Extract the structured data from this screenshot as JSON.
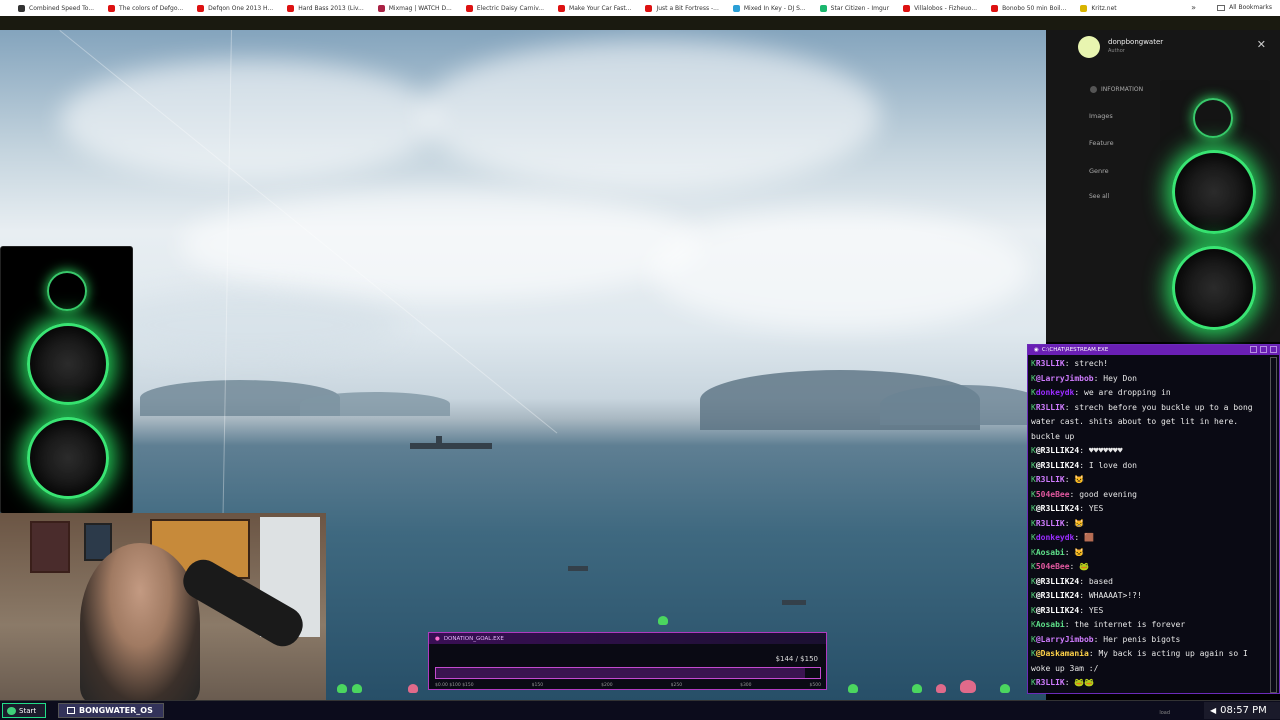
{
  "bookmarks": {
    "items": [
      {
        "label": "Combined Speed To...",
        "icon": "speed-icon",
        "color": "#333333"
      },
      {
        "label": "The colors of Defgo...",
        "icon": "youtube-icon",
        "color": "#dd1111"
      },
      {
        "label": "Defqon One 2013 H...",
        "icon": "youtube-icon",
        "color": "#dd1111"
      },
      {
        "label": "Hard Bass 2013 (Liv...",
        "icon": "youtube-icon",
        "color": "#dd1111"
      },
      {
        "label": "Mixmag | WATCH D...",
        "icon": "mixmag-icon",
        "color": "#aa2244"
      },
      {
        "label": "Electric Daisy Carniv...",
        "icon": "youtube-icon",
        "color": "#dd1111"
      },
      {
        "label": "Make Your Car Fast...",
        "icon": "youtube-icon",
        "color": "#dd1111"
      },
      {
        "label": "Just a Bit Fortress -...",
        "icon": "youtube-icon",
        "color": "#dd1111"
      },
      {
        "label": "Mixed In Key - DJ S...",
        "icon": "mixedinkey-icon",
        "color": "#2a9fd6"
      },
      {
        "label": "Star Citizen - Imgur",
        "icon": "imgur-icon",
        "color": "#1bb76e"
      },
      {
        "label": "Villalobos - Fizheuo...",
        "icon": "youtube-icon",
        "color": "#dd1111"
      },
      {
        "label": "Bonobo 50 min Boil...",
        "icon": "youtube-icon",
        "color": "#dd1111"
      },
      {
        "label": "Kritz.net",
        "icon": "kritz-icon",
        "color": "#d8b400"
      }
    ],
    "all_label": "All Bookmarks"
  },
  "panel": {
    "author_name": "donpbongwater",
    "author_role": "Author",
    "section": "INFORMATION",
    "links": [
      "Images",
      "Feature",
      "Genre",
      "See all"
    ]
  },
  "chat": {
    "title": "C:\\CHAT\\RESTREAM.EXE",
    "messages": [
      {
        "user": "R3LLIK",
        "text": "strech!",
        "color": "#d07cff"
      },
      {
        "user": "@LarryJimbob",
        "text": "Hey Don",
        "color": "#d07cff"
      },
      {
        "user": "donkeydk",
        "text": "we are dropping in",
        "color": "#9a2cff"
      },
      {
        "user": "R3LLIK",
        "text": "strech before you buckle up to a bong water cast. shits about to get lit in here. buckle up",
        "color": "#d07cff"
      },
      {
        "user": "@R3LLIK24",
        "text": "♥♥♥♥♥♥♥",
        "color": "#ffffff"
      },
      {
        "user": "@R3LLIK24",
        "text": "I love don",
        "color": "#ffffff"
      },
      {
        "user": "R3LLIK",
        "text": "😺",
        "color": "#d07cff"
      },
      {
        "user": "504eBee",
        "text": "good evening",
        "color": "#e0589f"
      },
      {
        "user": "@R3LLIK24",
        "text": "YES",
        "color": "#ffffff"
      },
      {
        "user": "R3LLIK",
        "text": "😸",
        "color": "#d07cff"
      },
      {
        "user": "donkeydk",
        "text": "🟫",
        "color": "#9a2cff"
      },
      {
        "user": "Aosabi",
        "text": "🐱",
        "color": "#5fe08a"
      },
      {
        "user": "504eBee",
        "text": "🐸",
        "color": "#e0589f"
      },
      {
        "user": "@R3LLIK24",
        "text": "based",
        "color": "#ffffff"
      },
      {
        "user": "@R3LLIK24",
        "text": "WHAAAAT>!?!",
        "color": "#ffffff"
      },
      {
        "user": "@R3LLIK24",
        "text": "YES",
        "color": "#ffffff"
      },
      {
        "user": "Aosabi",
        "text": "the internet is forever",
        "color": "#5fe08a"
      },
      {
        "user": "@LarryJimbob",
        "text": "Her penis bigots",
        "color": "#d07cff"
      },
      {
        "user": "@Daskamania",
        "text": "My back is acting up again so I woke up 3am :/",
        "color": "#ffd24a"
      },
      {
        "user": "R3LLIK",
        "text": "🐸🐸",
        "color": "#d07cff"
      }
    ]
  },
  "donation": {
    "title": "DONATION_GOAL.EXE",
    "amount": "$144 / $150",
    "progress": 0.96,
    "tiers": [
      "$0.00 $100 $150",
      "$150",
      "$200",
      "$250",
      "$300",
      "$500"
    ]
  },
  "taskbar": {
    "start_label": "Start",
    "app_label": "BONGWATER_OS",
    "time": "08:57 PM",
    "load_label": "load"
  },
  "colors": {
    "accent_green": "#39e573",
    "chat_purple": "#6a1fb4",
    "donation_pink": "#c34ad0"
  }
}
